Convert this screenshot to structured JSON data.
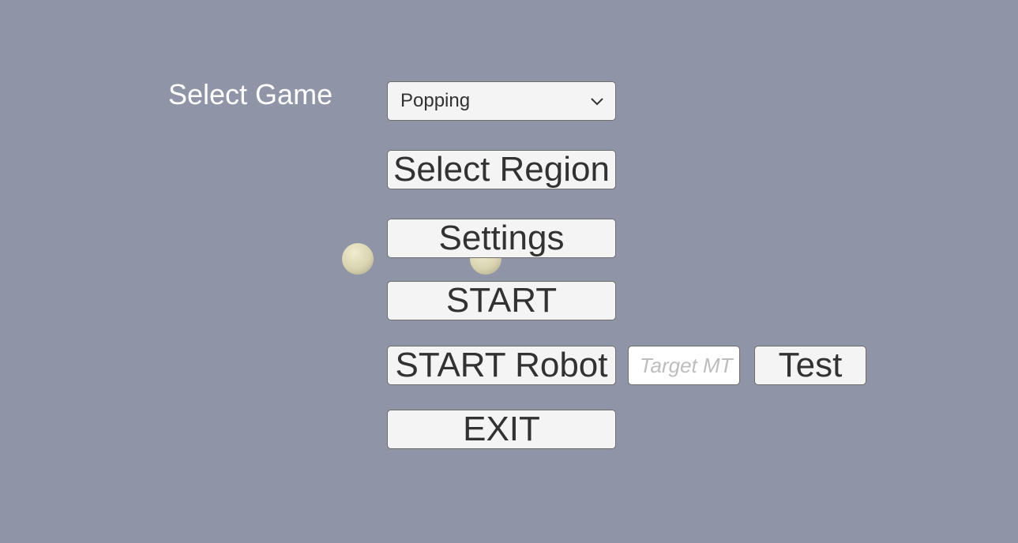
{
  "colors": {
    "background": "#8f95a6",
    "button": "#f4f4f4",
    "text": "#323232"
  },
  "select_game": {
    "label": "Select Game",
    "selected": "Popping",
    "icon": "chevron-down-icon"
  },
  "buttons": {
    "select_region": "Select Region",
    "settings": "Settings",
    "start": "START",
    "start_robot": "START Robot",
    "test": "Test",
    "exit": "EXIT"
  },
  "target_input": {
    "placeholder": "Target MT",
    "value": ""
  }
}
